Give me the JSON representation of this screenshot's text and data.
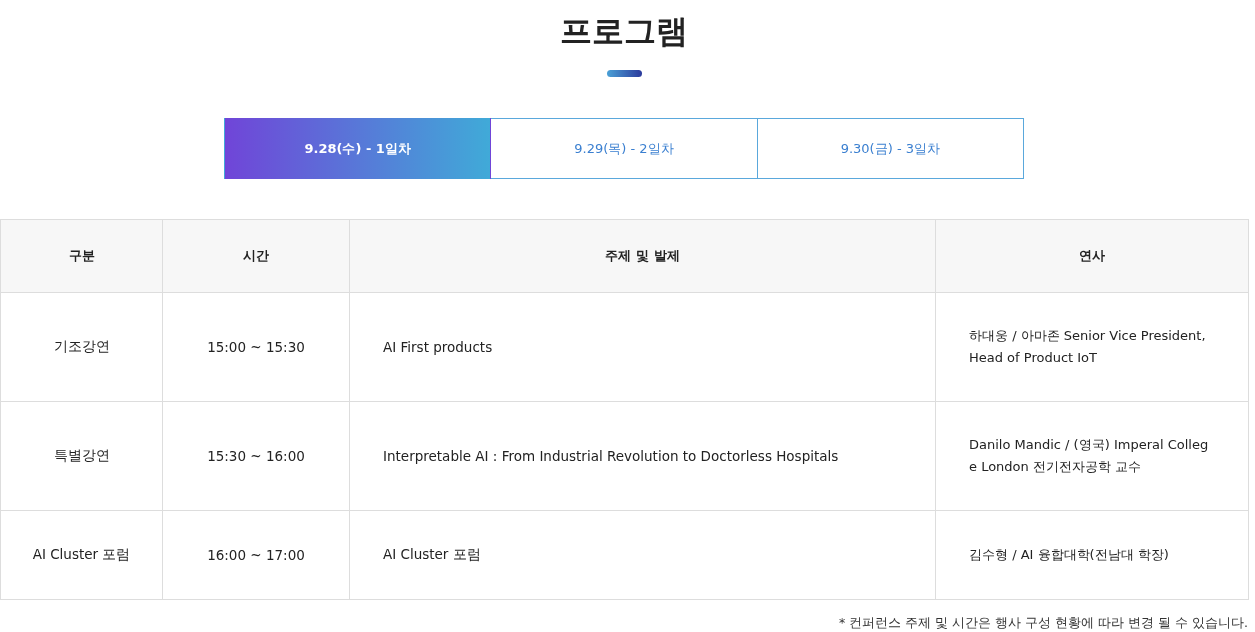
{
  "page_title": "프로그램",
  "tabs": [
    {
      "label": "9.28(수) - 1일차",
      "selected": true
    },
    {
      "label": "9.29(목) - 2일차",
      "selected": false
    },
    {
      "label": "9.30(금) - 3일차",
      "selected": false
    }
  ],
  "table": {
    "columns": [
      "구분",
      "시간",
      "주제 및 발제",
      "연사"
    ],
    "rows": [
      {
        "category": "기조강연",
        "time": "15:00 ~ 15:30",
        "topic": "AI First products",
        "speaker_lines": [
          "하대웅 / 아마존 Senior Vice President,",
          "Head of Product IoT"
        ]
      },
      {
        "category": "특별강연",
        "time": "15:30 ~ 16:00",
        "topic": "Interpretable AI : From Industrial Revolution to Doctorless Hospitals",
        "speaker_lines": [
          "Danilo Mandic / (영국) Imperal Colleg",
          "e London 전기전자공학 교수"
        ]
      },
      {
        "category": "AI Cluster 포럼",
        "time": "16:00 ~ 17:00",
        "topic": "AI Cluster 포럼",
        "speaker_lines": [
          "김수형 / AI 융합대학(전남대 학장)"
        ]
      }
    ]
  },
  "note": "* 컨퍼런스 주제 및 시간은 행사 구성 현황에 따라 변경 될 수 있습니다."
}
